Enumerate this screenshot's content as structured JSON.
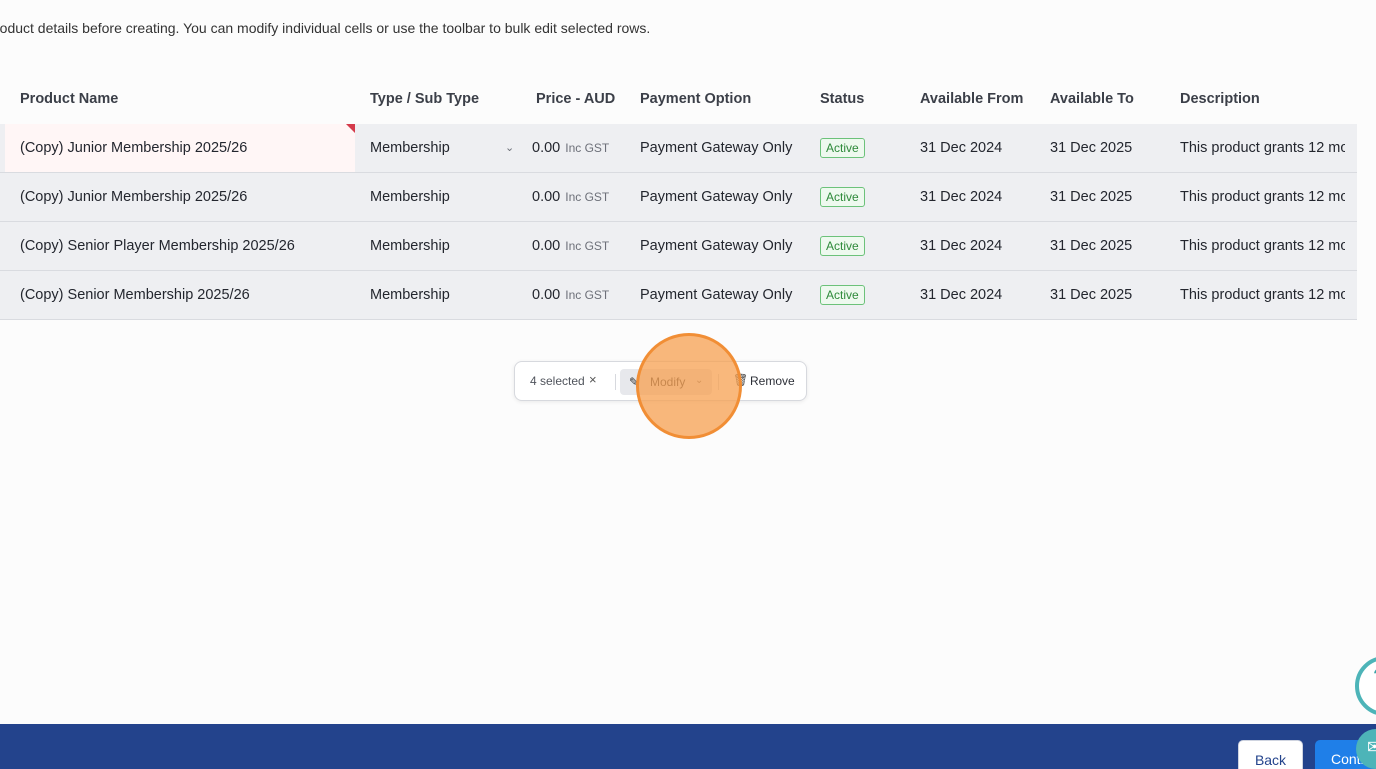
{
  "intro": "roduct details before creating. You can modify individual cells or use the toolbar to bulk edit selected rows.",
  "table": {
    "headers": {
      "name": "Product Name",
      "type": "Type / Sub Type",
      "price": "Price - AUD",
      "payment": "Payment Option",
      "status": "Status",
      "from": "Available From",
      "to": "Available To",
      "desc": "Description"
    },
    "rows": [
      {
        "name": "(Copy) Junior Membership 2025/26",
        "type": "Membership",
        "price": "0.00",
        "price_suffix": "Inc GST",
        "payment": "Payment Gateway Only",
        "status": "Active",
        "from": "31 Dec 2024",
        "to": "31 Dec 2025",
        "desc": "This product grants 12 mo"
      },
      {
        "name": "(Copy) Junior Membership 2025/26",
        "type": "Membership",
        "price": "0.00",
        "price_suffix": "Inc GST",
        "payment": "Payment Gateway Only",
        "status": "Active",
        "from": "31 Dec 2024",
        "to": "31 Dec 2025",
        "desc": "This product grants 12 mo"
      },
      {
        "name": "(Copy) Senior Player Membership 2025/26",
        "type": "Membership",
        "price": "0.00",
        "price_suffix": "Inc GST",
        "payment": "Payment Gateway Only",
        "status": "Active",
        "from": "31 Dec 2024",
        "to": "31 Dec 2025",
        "desc": "This product grants 12 mo"
      },
      {
        "name": "(Copy) Senior Membership 2025/26",
        "type": "Membership",
        "price": "0.00",
        "price_suffix": "Inc GST",
        "payment": "Payment Gateway Only",
        "status": "Active",
        "from": "31 Dec 2024",
        "to": "31 Dec 2025",
        "desc": "This product grants 12 mo"
      }
    ]
  },
  "toolbar": {
    "selected": "4 selected",
    "modify": "Modify",
    "remove": "Remove"
  },
  "footer": {
    "back": "Back",
    "continue": "Conti"
  },
  "colors": {
    "footer": "#23438c",
    "primary": "#1f7fe8",
    "active_badge": "#2e8a3a",
    "error_marker": "#d43a4b",
    "help": "#4db4b8"
  },
  "icons": {
    "clear": "close-icon",
    "modify": "pencil-icon",
    "remove": "trash-icon",
    "dropdown": "chevron-down-icon",
    "help": "help-icon",
    "chat": "chat-icon"
  }
}
